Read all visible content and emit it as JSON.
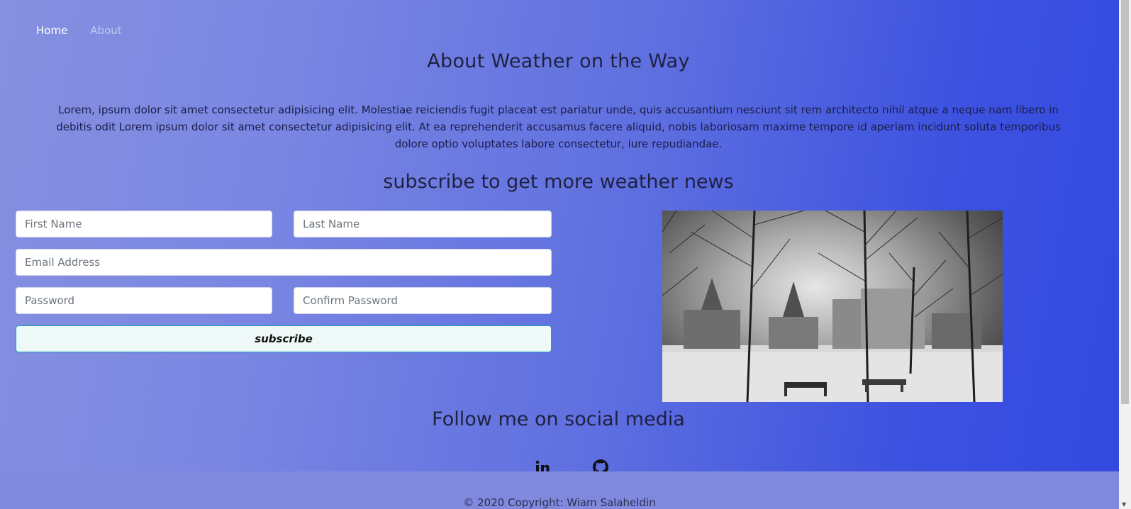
{
  "nav": {
    "home": "Home",
    "about": "About"
  },
  "about": {
    "title": "About Weather on the Way",
    "text": "Lorem, ipsum dolor sit amet consectetur adipisicing elit. Molestiae reiciendis fugit placeat est pariatur unde, quis accusantium nesciunt sit rem architecto nihil atque a neque nam libero in debitis odit Lorem ipsum dolor sit amet consectetur adipisicing elit. At ea reprehenderit accusamus facere aliquid, nobis laboriosam maxime tempore id aperiam incidunt soluta temporibus dolore optio voluptates labore consectetur, iure repudiandae."
  },
  "subscribe": {
    "heading": "subscribe to get more weather news",
    "first_name_placeholder": "First Name",
    "last_name_placeholder": "Last Name",
    "email_placeholder": "Email Address",
    "password_placeholder": "Password",
    "confirm_password_placeholder": "Confirm Password",
    "button_label": "subscribe"
  },
  "image": {
    "subject": "snowy campus park with bare trees and benches, black and white"
  },
  "social": {
    "heading": "Follow me on social media",
    "icons": [
      "linkedin-icon",
      "github-icon"
    ]
  },
  "footer": {
    "copyright": "© 2020 Copyright: Wiam Salaheldin"
  },
  "colors": {
    "gradient_start": "#8690e0",
    "gradient_end": "#3249df",
    "button_border": "#17a2b8"
  }
}
